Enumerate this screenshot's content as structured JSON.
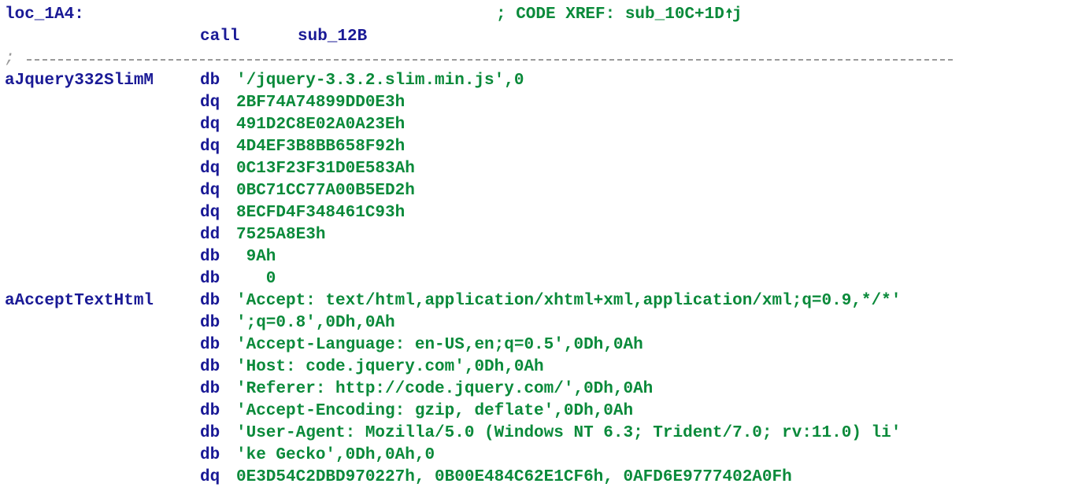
{
  "listing": {
    "loc_label": "loc_1A4:",
    "loc_comment_prefix": "; CODE XREF: sub_10C+1D",
    "loc_comment_suffix": "j",
    "call_mnemonic": "call",
    "call_target": "sub_12B",
    "separator_semicolon": ";",
    "rows": [
      {
        "label": "aJquery332SlimM",
        "mnemonic": "db",
        "operand": "'/jquery-3.3.2.slim.min.js',0"
      },
      {
        "label": "",
        "mnemonic": "dq",
        "operand": "2BF74A74899DD0E3h"
      },
      {
        "label": "",
        "mnemonic": "dq",
        "operand": "491D2C8E02A0A23Eh"
      },
      {
        "label": "",
        "mnemonic": "dq",
        "operand": "4D4EF3B8BB658F92h"
      },
      {
        "label": "",
        "mnemonic": "dq",
        "operand": "0C13F23F31D0E583Ah"
      },
      {
        "label": "",
        "mnemonic": "dq",
        "operand": "0BC71CC77A00B5ED2h"
      },
      {
        "label": "",
        "mnemonic": "dq",
        "operand": "8ECFD4F348461C93h"
      },
      {
        "label": "",
        "mnemonic": "dd",
        "operand": "7525A8E3h"
      },
      {
        "label": "",
        "mnemonic": "db",
        "operand": " 9Ah"
      },
      {
        "label": "",
        "mnemonic": "db",
        "operand": "   0"
      },
      {
        "label": "aAcceptTextHtml",
        "mnemonic": "db",
        "operand": "'Accept: text/html,application/xhtml+xml,application/xml;q=0.9,*/*'"
      },
      {
        "label": "",
        "mnemonic": "db",
        "operand": "';q=0.8',0Dh,0Ah"
      },
      {
        "label": "",
        "mnemonic": "db",
        "operand": "'Accept-Language: en-US,en;q=0.5',0Dh,0Ah"
      },
      {
        "label": "",
        "mnemonic": "db",
        "operand": "'Host: code.jquery.com',0Dh,0Ah"
      },
      {
        "label": "",
        "mnemonic": "db",
        "operand": "'Referer: http://code.jquery.com/',0Dh,0Ah"
      },
      {
        "label": "",
        "mnemonic": "db",
        "operand": "'Accept-Encoding: gzip, deflate',0Dh,0Ah"
      },
      {
        "label": "",
        "mnemonic": "db",
        "operand": "'User-Agent: Mozilla/5.0 (Windows NT 6.3; Trident/7.0; rv:11.0) li'"
      },
      {
        "label": "",
        "mnemonic": "db",
        "operand": "'ke Gecko',0Dh,0Ah,0"
      },
      {
        "label": "",
        "mnemonic": "dq",
        "operand": "0E3D54C2DBD970227h, 0B00E484C62E1CF6h, 0AFD6E9777402A0Fh"
      }
    ]
  },
  "colors": {
    "label_blue": "#1a1a96",
    "operand_green": "#0a8a3a",
    "separator_gray": "#9a9a9a",
    "background": "#ffffff"
  }
}
